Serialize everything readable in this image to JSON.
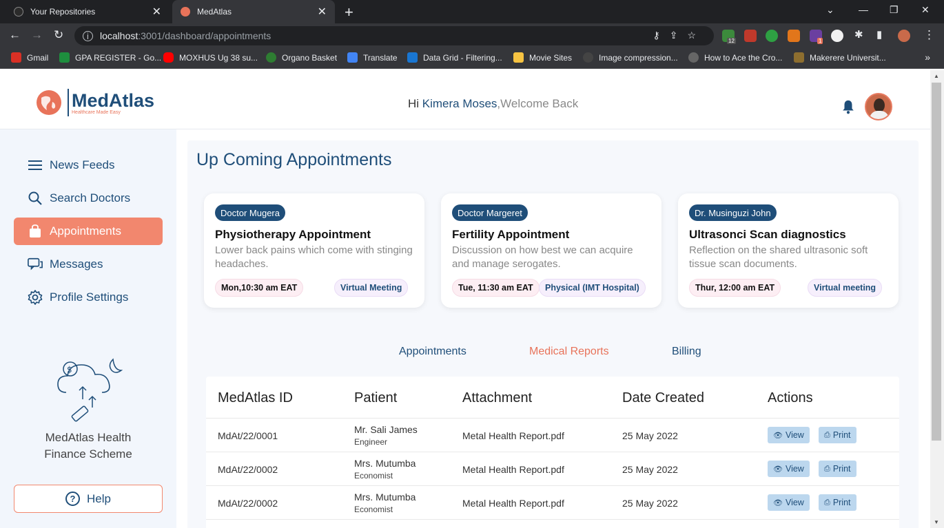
{
  "browser": {
    "tabs": [
      {
        "title": "Your Repositories",
        "active": false
      },
      {
        "title": "MedAtlas",
        "active": true
      }
    ],
    "url_host": "localhost",
    "url_path": ":3001/dashboard/appointments",
    "extension_badges": [
      "12",
      "1"
    ],
    "bookmarks": [
      "Gmail",
      "GPA REGISTER - Go...",
      "MOXHUS Ug 38 su...",
      "Organo Basket",
      "Translate",
      "Data Grid - Filtering...",
      "Movie Sites",
      "Image compression...",
      "How to Ace the Cro...",
      "Makerere Universit..."
    ]
  },
  "header": {
    "brand": "MedAtlas",
    "tagline": "Healthcare Made Easy",
    "greeting_hi": "Hi ",
    "user_name": "Kimera Moses",
    "greeting_rest": ",Welcome Back"
  },
  "sidebar": {
    "items": [
      {
        "label": "News Feeds",
        "icon": "menu-icon",
        "active": false
      },
      {
        "label": "Search Doctors",
        "icon": "search-icon",
        "active": false
      },
      {
        "label": "Appointments",
        "icon": "shopping-bag-icon",
        "active": true
      },
      {
        "label": "Messages",
        "icon": "chat-icon",
        "active": false
      },
      {
        "label": "Profile Settings",
        "icon": "gear-icon",
        "active": false
      }
    ],
    "scheme_line1": "MedAtlas Health",
    "scheme_line2": "Finance Scheme",
    "help_label": "Help"
  },
  "main": {
    "title": "Up Coming Appointments",
    "cards": [
      {
        "doctor": "Doctor Mugera",
        "title": "Physiotherapy Appointment",
        "description": "Lower back pains which come with stinging headaches.",
        "time": "Mon,10:30 am EAT",
        "mode": "Virtual Meeting"
      },
      {
        "doctor": "Doctor Margeret",
        "title": "Fertility Appointment",
        "description": "Discussion on how best we can acquire and manage serogates.",
        "time": "Tue, 11:30 am EAT",
        "mode": "Physical (IMT Hospital)"
      },
      {
        "doctor": "Dr. Musinguzi John",
        "title": "Ultrasonci Scan diagnostics",
        "description": "Reflection on the shared ultrasonic soft tissue scan documents.",
        "time": "Thur, 12:00 am EAT",
        "mode": "Virtual meeting"
      }
    ],
    "tabs": [
      {
        "label": "Appointments",
        "active": false
      },
      {
        "label": "Medical Reports",
        "active": true
      },
      {
        "label": "Billing",
        "active": false
      }
    ],
    "table": {
      "headers": [
        "MedAtlas ID",
        "Patient",
        "Attachment",
        "Date Created",
        "Actions"
      ],
      "view_label": "View",
      "print_label": "Print",
      "rows": [
        {
          "id": "MdAt/22/0001",
          "patient": "Mr. Sali James",
          "occupation": "Engineer",
          "attachment": "Metal Health Report.pdf",
          "date": "25 May 2022"
        },
        {
          "id": "MdAt/22/0002",
          "patient": "Mrs. Mutumba",
          "occupation": "Economist",
          "attachment": "Metal Health Report.pdf",
          "date": "25 May 2022"
        },
        {
          "id": "MdAt/22/0002",
          "patient": "Mrs. Mutumba",
          "occupation": "Economist",
          "attachment": "Metal Health Report.pdf",
          "date": "25 May 2022"
        }
      ]
    }
  },
  "colors": {
    "primary": "#1f4e79",
    "accent": "#f2876e",
    "sidebar_bg": "#f2f6fc"
  }
}
